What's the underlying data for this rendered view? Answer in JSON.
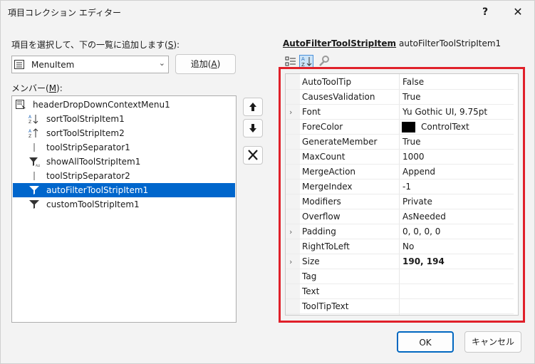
{
  "window": {
    "title": "項目コレクション エディター",
    "help_label": "?",
    "close_label": "✕"
  },
  "left": {
    "select_label_prefix": "項目を選択して、下の一覧に追加します(",
    "select_label_key": "S",
    "select_label_suffix": "):",
    "type_select": {
      "value": "MenuItem",
      "icon": "menu-item-icon"
    },
    "add_button_prefix": "追加(",
    "add_button_key": "A",
    "add_button_suffix": ")",
    "members_label_prefix": "メンバー(",
    "members_label_key": "M",
    "members_label_suffix": "):",
    "members": [
      {
        "label": "headerDropDownContextMenu1",
        "icon": "context-menu-icon",
        "indent": 0,
        "selected": false
      },
      {
        "label": "sortToolStripItem1",
        "icon": "sort-icon",
        "indent": 1,
        "selected": false
      },
      {
        "label": "sortToolStripItem2",
        "icon": "sort-icon",
        "indent": 1,
        "selected": false
      },
      {
        "label": "toolStripSeparator1",
        "icon": "separator-icon",
        "indent": 1,
        "selected": false
      },
      {
        "label": "showAllToolStripItem1",
        "icon": "filter-all-icon",
        "indent": 1,
        "selected": false
      },
      {
        "label": "toolStripSeparator2",
        "icon": "separator-icon",
        "indent": 1,
        "selected": false
      },
      {
        "label": "autoFilterToolStripItem1",
        "icon": "filter-icon",
        "indent": 1,
        "selected": true
      },
      {
        "label": "customToolStripItem1",
        "icon": "filter-icon",
        "indent": 1,
        "selected": false
      }
    ],
    "side_buttons": [
      "move-up-icon",
      "move-down-icon",
      "delete-icon"
    ]
  },
  "right": {
    "type_name": "AutoFilterToolStripItem",
    "object_name": "autoFilterToolStripItem1",
    "toolbar": [
      "categorized-icon",
      "alphabetical-icon",
      "property-pages-icon"
    ],
    "properties": [
      {
        "name": "AutoToolTip",
        "value": "False",
        "expandable": false,
        "bold": false
      },
      {
        "name": "CausesValidation",
        "value": "True",
        "expandable": false,
        "bold": false
      },
      {
        "name": "Font",
        "value": "Yu Gothic UI, 9.75pt",
        "expandable": true,
        "bold": false
      },
      {
        "name": "ForeColor",
        "value": "ControlText",
        "expandable": false,
        "bold": false,
        "swatch": "#000000"
      },
      {
        "name": "GenerateMember",
        "value": "True",
        "expandable": false,
        "bold": false
      },
      {
        "name": "MaxCount",
        "value": "1000",
        "expandable": false,
        "bold": false
      },
      {
        "name": "MergeAction",
        "value": "Append",
        "expandable": false,
        "bold": false
      },
      {
        "name": "MergeIndex",
        "value": "-1",
        "expandable": false,
        "bold": false
      },
      {
        "name": "Modifiers",
        "value": "Private",
        "expandable": false,
        "bold": false
      },
      {
        "name": "Overflow",
        "value": "AsNeeded",
        "expandable": false,
        "bold": false
      },
      {
        "name": "Padding",
        "value": "0, 0, 0, 0",
        "expandable": true,
        "bold": false
      },
      {
        "name": "RightToLeft",
        "value": "No",
        "expandable": false,
        "bold": false
      },
      {
        "name": "Size",
        "value": "190, 194",
        "expandable": true,
        "bold": true
      },
      {
        "name": "Tag",
        "value": "",
        "expandable": false,
        "bold": false
      },
      {
        "name": "Text",
        "value": "",
        "expandable": false,
        "bold": false
      },
      {
        "name": "ToolTipText",
        "value": "",
        "expandable": false,
        "bold": false
      }
    ],
    "highlight_color": "#e0202a"
  },
  "footer": {
    "ok_label": "OK",
    "cancel_label": "キャンセル"
  }
}
